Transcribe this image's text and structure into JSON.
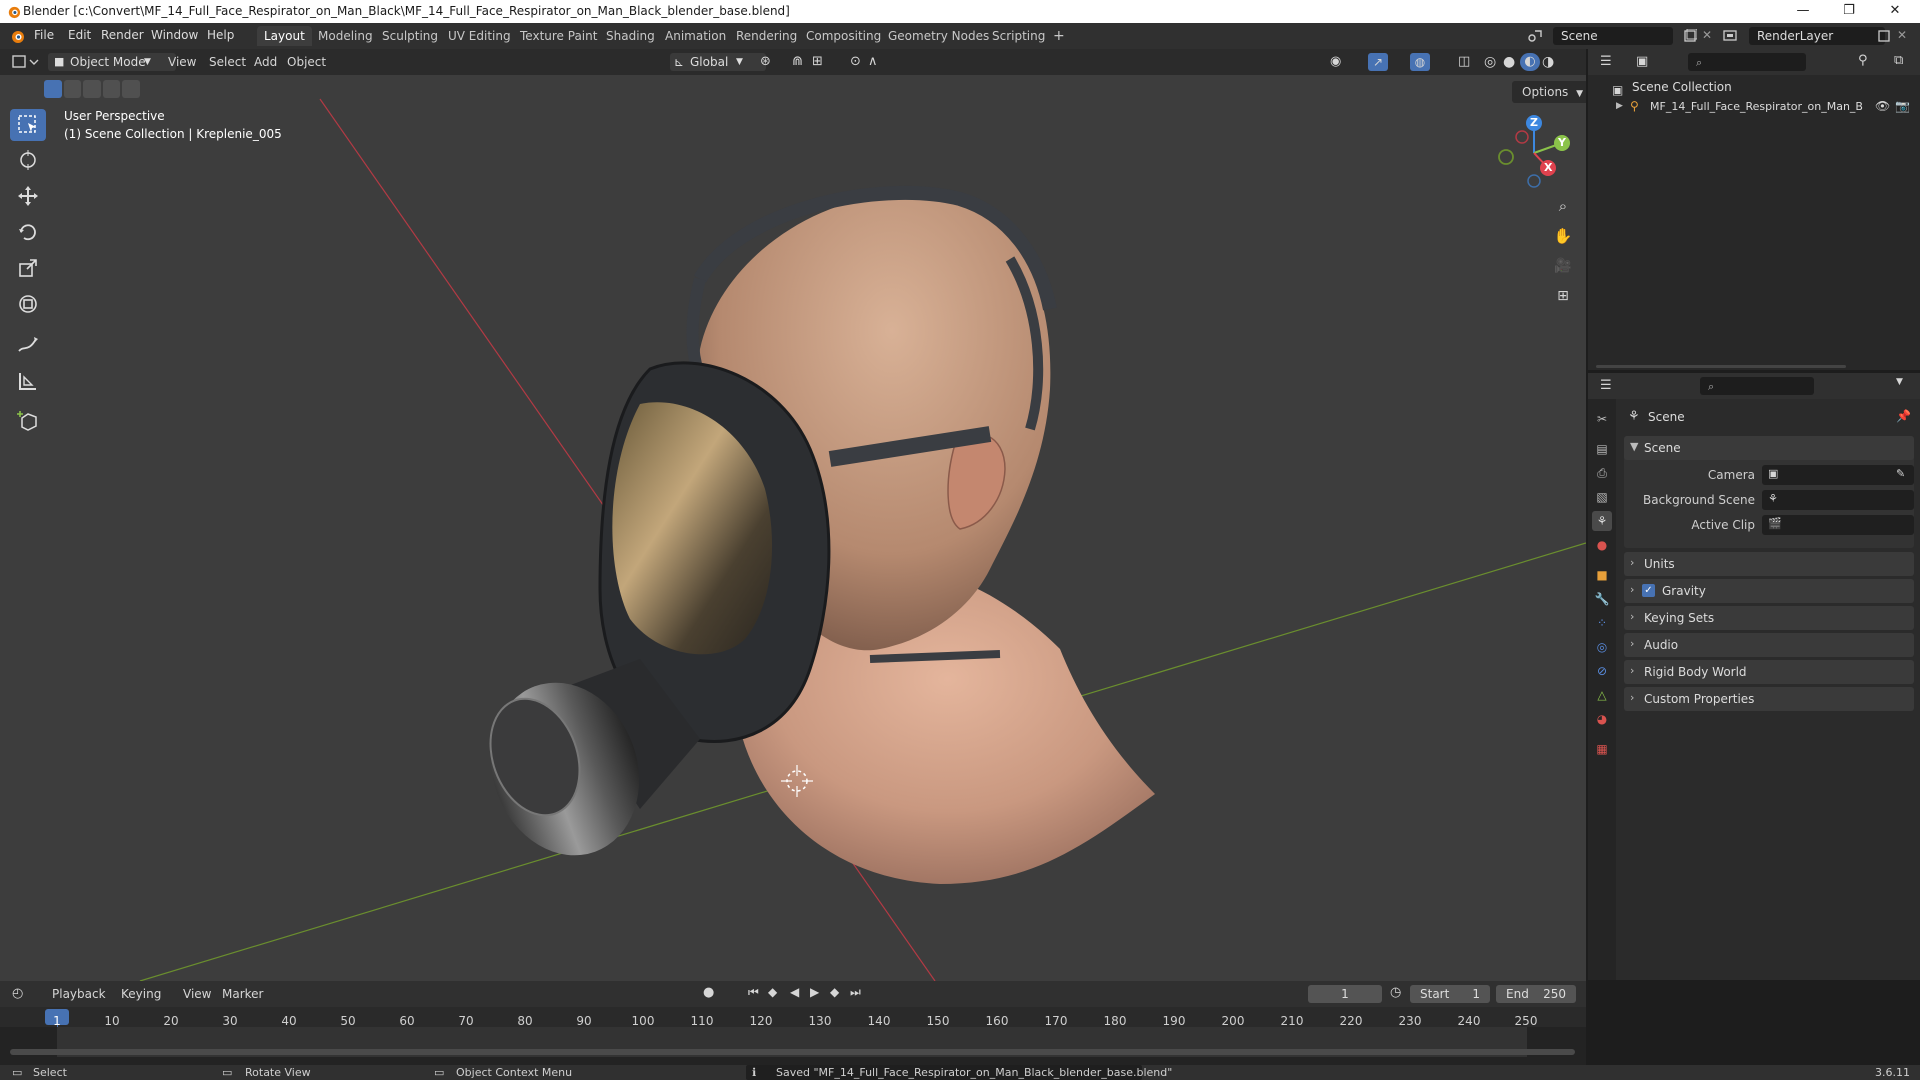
{
  "window": {
    "title": "Blender [c:\\Convert\\MF_14_Full_Face_Respirator_on_Man_Black\\MF_14_Full_Face_Respirator_on_Man_Black_blender_base.blend]",
    "controls": [
      "—",
      "❐",
      "✕"
    ]
  },
  "menu": {
    "items": [
      "File",
      "Edit",
      "Render",
      "Window",
      "Help"
    ]
  },
  "workspaces": {
    "tabs": [
      "Layout",
      "Modeling",
      "Sculpting",
      "UV Editing",
      "Texture Paint",
      "Shading",
      "Animation",
      "Rendering",
      "Compositing",
      "Geometry Nodes",
      "Scripting"
    ],
    "active": "Layout",
    "add": "+"
  },
  "top_right": {
    "scene": "Scene",
    "view_layer": "RenderLayer"
  },
  "viewport_header": {
    "mode": "Object Mode",
    "menus": [
      "View",
      "Select",
      "Add",
      "Object"
    ],
    "transform_orientation": "Global",
    "options": "Options"
  },
  "viewport": {
    "perspective": "User Perspective",
    "collection_info": "(1) Scene Collection | Kreplenie_005",
    "gizmo": {
      "z": "Z",
      "y": "Y",
      "x": "X"
    }
  },
  "outliner": {
    "root": "Scene Collection",
    "item": "MF_14_Full_Face_Respirator_on_Man_B"
  },
  "properties": {
    "breadcrumb": "Scene",
    "section": "Scene",
    "fields": [
      {
        "label": "Camera"
      },
      {
        "label": "Background Scene"
      },
      {
        "label": "Active Clip"
      }
    ],
    "panels": [
      "Units",
      "Gravity",
      "Keying Sets",
      "Audio",
      "Rigid Body World",
      "Custom Properties"
    ],
    "gravity_enabled": true
  },
  "timeline": {
    "menus": [
      "Playback",
      "Keying",
      "View",
      "Marker"
    ],
    "current_frame": "1",
    "start_label": "Start",
    "start": "1",
    "end_label": "End",
    "end": "250",
    "ruler": [
      "1",
      "10",
      "20",
      "30",
      "40",
      "50",
      "60",
      "70",
      "80",
      "90",
      "100",
      "110",
      "120",
      "130",
      "140",
      "150",
      "160",
      "170",
      "180",
      "190",
      "200",
      "210",
      "220",
      "230",
      "240",
      "250"
    ]
  },
  "statusbar": {
    "select": "Select",
    "rotate": "Rotate View",
    "context": "Object Context Menu",
    "message": "Saved \"MF_14_Full_Face_Respirator_on_Man_Black_blender_base.blend\"",
    "version": "3.6.11"
  },
  "colors": {
    "accent": "#4772b3",
    "x_axis": "#e0424e",
    "y_axis": "#8bc34a",
    "z_axis": "#3d88e0"
  }
}
